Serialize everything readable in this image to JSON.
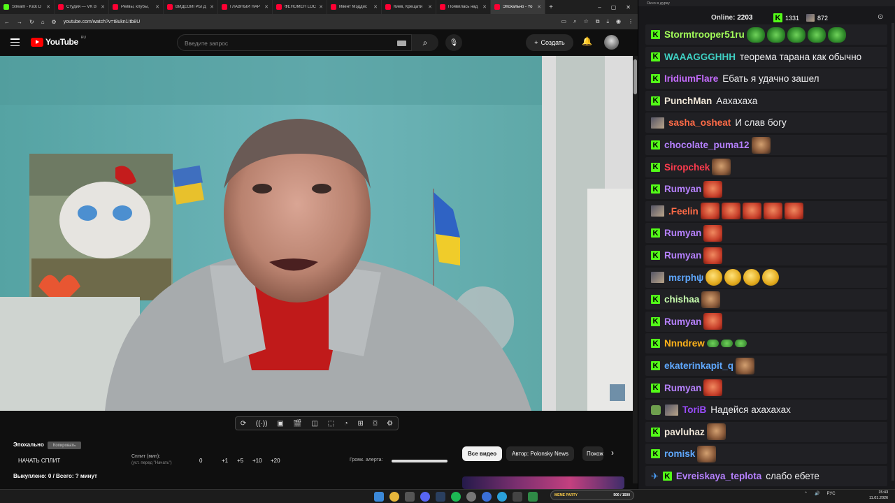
{
  "browser": {
    "tabs": [
      {
        "label": "Stream - Kick D",
        "color": "#53fc18",
        "active": false
      },
      {
        "label": "Студия — VK В",
        "color": "#ff0033",
        "active": false
      },
      {
        "label": "Рейвы, клубы,",
        "color": "#ff0033",
        "active": false
      },
      {
        "label": "ВИДЕОИГРЫ Д",
        "color": "#ff0033",
        "active": false
      },
      {
        "label": "ГЛАВНЫЙ НАР",
        "color": "#ff0033",
        "active": false
      },
      {
        "label": "ФЕНОМЕН LOC",
        "color": "#ff0033",
        "active": false
      },
      {
        "label": "Ивент Мэддис",
        "color": "#ff0033",
        "active": false
      },
      {
        "label": "Киев, Крещати",
        "color": "#ff0033",
        "active": false
      },
      {
        "label": "Появилась над",
        "color": "#ff0033",
        "active": false
      },
      {
        "label": "Эпохально - Yo",
        "color": "#ff0033",
        "active": true
      }
    ],
    "url": "youtube.com/watch?v=t8ukn1Itb8U"
  },
  "youtube": {
    "logo_text": "YouTube",
    "region": "RU",
    "search_placeholder": "Введите запрос",
    "create_label": "Создать"
  },
  "panel": {
    "title": "Эпохально",
    "copy_label": "Копировать",
    "start_split": "НАЧАТЬ СПЛИТ",
    "split_label": "Сплит (мин):",
    "split_sub": "(уст. перед \"Начать\")",
    "split_buttons": [
      "0",
      "+1",
      "+5",
      "+10",
      "+20"
    ],
    "alert_label": "Громк. алерта:",
    "bought": "Выкуплено: 0 / Всего: ? минут"
  },
  "chips": {
    "all": "Все видео",
    "author": "Автор: Polonsky News",
    "similar": "Похожие"
  },
  "chat": {
    "window_title": "Окно в дурку",
    "online_label": "Online:",
    "online_count": "2203",
    "k_count": "1331",
    "viewer_count": "872",
    "top_fragment": "да да я",
    "messages": [
      {
        "user": "Stormtrooper51ru",
        "color": "#a3ff5a",
        "badge": "k",
        "text": "",
        "emotes": [
          "pepe",
          "pepe",
          "pepe",
          "pepe",
          "pepe"
        ]
      },
      {
        "user": "WAAAGGGHHH",
        "color": "#3fd1c4",
        "badge": "k",
        "text": "теорема тарана как обычно",
        "emotes": []
      },
      {
        "user": "IridiumFlare",
        "color": "#c56cff",
        "badge": "k",
        "text": "Ебать я удачно зашел",
        "emotes": []
      },
      {
        "user": "PunchMan",
        "color": "#f0e7d8",
        "badge": "k",
        "text": "Аахахаха",
        "emotes": []
      },
      {
        "user": "sasha_osheat",
        "color": "#ff6b47",
        "badge": "av",
        "text": "И слав богу",
        "emotes": []
      },
      {
        "user": "chocolate_puma12",
        "color": "#b681ff",
        "badge": "k",
        "text": "",
        "emotes": [
          "face"
        ]
      },
      {
        "user": "Siropchek",
        "color": "#ff3b4e",
        "badge": "k",
        "text": "",
        "emotes": [
          "face"
        ]
      },
      {
        "user": "Rumyan",
        "color": "#b681ff",
        "badge": "k",
        "text": "",
        "emotes": [
          "rage"
        ]
      },
      {
        "user": ".Feelin",
        "color": "#ff6b47",
        "badge": "av",
        "text": "",
        "emotes": [
          "rage",
          "rage",
          "rage",
          "rage",
          "rage"
        ]
      },
      {
        "user": "Rumyan",
        "color": "#b681ff",
        "badge": "k",
        "text": "",
        "emotes": [
          "rage"
        ]
      },
      {
        "user": "Rumyan",
        "color": "#b681ff",
        "badge": "k",
        "text": "",
        "emotes": [
          "rage"
        ]
      },
      {
        "user": "mεrphψ",
        "color": "#5fa8ff",
        "badge": "av",
        "text": "",
        "emotes": [
          "emoji",
          "emoji",
          "emoji",
          "emoji"
        ]
      },
      {
        "user": "chishaa",
        "color": "#c9ffb0",
        "badge": "k",
        "text": "",
        "emotes": [
          "face"
        ]
      },
      {
        "user": "Rumyan",
        "color": "#b681ff",
        "badge": "k",
        "text": "",
        "emotes": [
          "rage"
        ]
      },
      {
        "user": "Nnndrew",
        "color": "#ffb31a",
        "badge": "k",
        "text": "",
        "emotes": [
          "smallpepe",
          "smallpepe",
          "smallpepe"
        ]
      },
      {
        "user": "ekaterinkapit_q",
        "color": "#5fa8ff",
        "badge": "k",
        "text": "",
        "emotes": [
          "face"
        ]
      },
      {
        "user": "Rumyan",
        "color": "#b681ff",
        "badge": "k",
        "text": "",
        "emotes": [
          "rage"
        ]
      },
      {
        "user": "ToriB",
        "color": "#9b4dff",
        "badge": "mod",
        "text": "Надейся ахахахах",
        "emotes": []
      },
      {
        "user": "pavluhaz",
        "color": "#f0e7d8",
        "badge": "k",
        "text": "",
        "emotes": [
          "face"
        ]
      },
      {
        "user": "romisk",
        "color": "#5fa8ff",
        "badge": "k",
        "text": "",
        "emotes": [
          "face"
        ]
      },
      {
        "user": "Evreiskaya_teplota",
        "color": "#b681ff",
        "badge": "pin",
        "text": "слабо ебете",
        "emotes": []
      }
    ]
  },
  "taskbar": {
    "meme_label": "MEME PARTY",
    "meme_count": "500 / 1500",
    "lang": "РУС",
    "time": "15:43",
    "date": "11.01.2026"
  }
}
